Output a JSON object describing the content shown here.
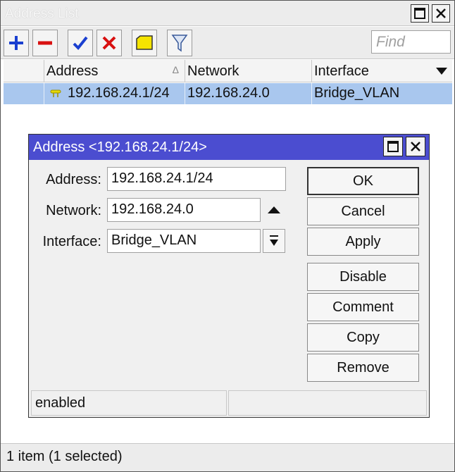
{
  "window": {
    "title": "Address List"
  },
  "toolbar": {
    "buttons": [
      {
        "name": "add-icon",
        "glyph": "+",
        "color": "#1a3fd0"
      },
      {
        "name": "remove-icon",
        "glyph": "−",
        "color": "#d81010"
      },
      {
        "name": "enable-icon",
        "glyph": "✔",
        "color": "#1a3fd0"
      },
      {
        "name": "disable-icon",
        "glyph": "✖",
        "color": "#d81010"
      },
      {
        "name": "comment-icon",
        "glyph": "",
        "color": "#e8d800"
      },
      {
        "name": "filter-icon",
        "glyph": "",
        "color": "#3a5a9a"
      }
    ],
    "find_placeholder": "Find"
  },
  "table": {
    "columns": [
      "Address",
      "Network",
      "Interface"
    ],
    "rows": [
      {
        "address": "192.168.24.1/24",
        "network": "192.168.24.0",
        "interface": "Bridge_VLAN"
      }
    ]
  },
  "status": {
    "text": "1 item (1 selected)"
  },
  "dialog": {
    "title": "Address <192.168.24.1/24>",
    "address_label": "Address:",
    "address_value": "192.168.24.1/24",
    "network_label": "Network:",
    "network_value": "192.168.24.0",
    "interface_label": "Interface:",
    "interface_value": "Bridge_VLAN",
    "buttons": {
      "ok": "OK",
      "cancel": "Cancel",
      "apply": "Apply",
      "disable": "Disable",
      "comment": "Comment",
      "copy": "Copy",
      "remove": "Remove"
    },
    "status_text": "enabled"
  },
  "colors": {
    "dialog_titlebar": "#4b4dd0",
    "row_selected": "#a9c7ee"
  }
}
